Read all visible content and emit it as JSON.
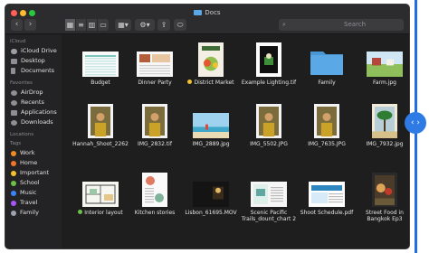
{
  "window": {
    "title": "Docs"
  },
  "toolbar": {
    "back_glyph": "‹",
    "forward_glyph": "›",
    "view_glyphs": [
      "▦",
      "≡",
      "▥",
      "▭"
    ],
    "group_glyph": "▦▾",
    "action_glyph": "⚙▾",
    "share_glyph": "⇪",
    "tag_glyph": "⬭"
  },
  "search": {
    "placeholder": "Search",
    "icon": "search-icon"
  },
  "sidebar": {
    "icloud_header": "iCloud",
    "icloud_items": [
      "iCloud Drive",
      "Desktop",
      "Documents"
    ],
    "favorites_header": "Favorites",
    "favorites_items": [
      "AirDrop",
      "Recents",
      "Applications",
      "Downloads"
    ],
    "locations_header": "Locations",
    "tags_header": "Tags",
    "tags": [
      {
        "label": "Work",
        "color": "#f08a24"
      },
      {
        "label": "Home",
        "color": "#f0752b"
      },
      {
        "label": "Important",
        "color": "#f2c12e"
      },
      {
        "label": "School",
        "color": "#6cc04a"
      },
      {
        "label": "Music",
        "color": "#3b82f6"
      },
      {
        "label": "Travel",
        "color": "#a855f7"
      },
      {
        "label": "Family",
        "color": "#9ca3af"
      }
    ]
  },
  "files": [
    {
      "name": "Budget",
      "kind": "spreadsheet"
    },
    {
      "name": "Dinner Party",
      "kind": "document"
    },
    {
      "name": "District Market",
      "kind": "poster",
      "tag_color": "#f2c12e"
    },
    {
      "name": "Example Lighting.tif",
      "kind": "photo-framed"
    },
    {
      "name": "Family",
      "kind": "folder"
    },
    {
      "name": "Farm.jpg",
      "kind": "photo"
    },
    {
      "name": "Hannah_Shoot_2262",
      "kind": "photo-portrait"
    },
    {
      "name": "IMG_2832.tif",
      "kind": "photo-portrait"
    },
    {
      "name": "IMG_2889.jpg",
      "kind": "photo-beach"
    },
    {
      "name": "IMG_5502.JPG",
      "kind": "photo-portrait"
    },
    {
      "name": "IMG_7635.JPG",
      "kind": "photo-portrait"
    },
    {
      "name": "IMG_7932.jpg",
      "kind": "photo-palm"
    },
    {
      "name": "Interior layout",
      "kind": "floorplan",
      "tag_color": "#6cc04a"
    },
    {
      "name": "Kitchen stories",
      "kind": "magazine"
    },
    {
      "name": "Lisbon_61695.MOV",
      "kind": "video"
    },
    {
      "name": "Scenic Pacific Trails_dount_chart 2",
      "kind": "brochure"
    },
    {
      "name": "Shoot Schedule.pdf",
      "kind": "pdf"
    },
    {
      "name": "Street Food in Bangkok Ep3",
      "kind": "photo-street"
    }
  ],
  "colors": {
    "accent": "#2f7be6",
    "folder": "#5aa9e6"
  }
}
